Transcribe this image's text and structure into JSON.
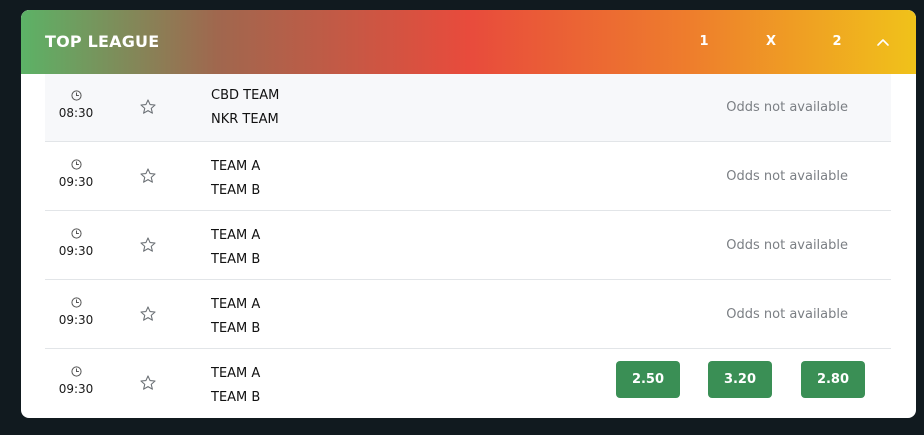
{
  "league": {
    "title": "TOP LEAGUE",
    "col_1": "1",
    "col_x": "X",
    "col_2": "2"
  },
  "matches": [
    {
      "time": "08:30",
      "home": "CBD TEAM",
      "away": "NKR TEAM",
      "odds_text": "Odds not available"
    },
    {
      "time": "09:30",
      "home": "TEAM A",
      "away": "TEAM B",
      "odds_text": "Odds not available"
    },
    {
      "time": "09:30",
      "home": "TEAM A",
      "away": "TEAM B",
      "odds_text": "Odds not available"
    },
    {
      "time": "09:30",
      "home": "TEAM A",
      "away": "TEAM B",
      "odds_text": "Odds not available"
    },
    {
      "time": "09:30",
      "home": "TEAM A",
      "away": "TEAM B",
      "odds": {
        "home": "2.50",
        "draw": "3.20",
        "away": "2.80"
      }
    }
  ],
  "colors": {
    "odds_button": "#3a8f55",
    "header_gradient": [
      "#5cb266",
      "#e84b3c",
      "#f0c21a"
    ]
  },
  "icons": [
    "clock-icon",
    "star-icon",
    "chevron-up-icon"
  ]
}
